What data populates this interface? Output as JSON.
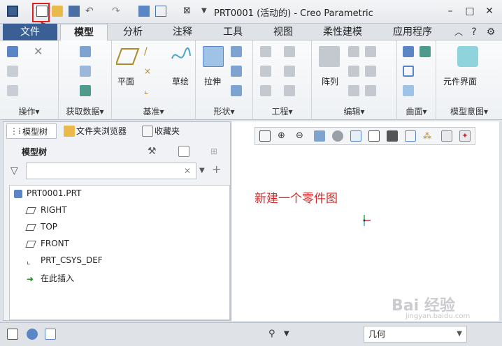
{
  "titlebar": {
    "title": "PRT0001 (活动的) - Creo Parametric",
    "quick_access": [
      "window-icon",
      "new-file-icon",
      "open-folder-icon",
      "save-icon",
      "undo-icon",
      "redo-icon",
      "regenerate-icon",
      "windows-icon",
      "close-window-icon"
    ]
  },
  "tabs": {
    "file": "文件",
    "items": [
      "模型",
      "分析",
      "注释",
      "工具",
      "视图",
      "柔性建模",
      "应用程序"
    ],
    "active": "模型"
  },
  "ribbon": {
    "groups": {
      "operations": "操作▾",
      "get_data": "获取数据▾",
      "datum": "基准▾",
      "shapes": "形状▾",
      "engineering": "工程▾",
      "editing": "编辑▾",
      "surfaces": "曲面▾",
      "model_intent": "模型意图▾"
    },
    "buttons": {
      "plane": "平面",
      "sketch": "草绘",
      "extrude": "拉伸",
      "pattern": "阵列",
      "component_interface": "元件界面"
    }
  },
  "left_panel": {
    "tabs": [
      "模型树",
      "文件夹浏览器",
      "收藏夹"
    ],
    "header": "模型树",
    "search_placeholder": "",
    "tree": [
      {
        "label": "PRT0001.PRT",
        "icon": "part-icon"
      },
      {
        "label": "RIGHT",
        "icon": "datum-plane-icon"
      },
      {
        "label": "TOP",
        "icon": "datum-plane-icon"
      },
      {
        "label": "FRONT",
        "icon": "datum-plane-icon"
      },
      {
        "label": "PRT_CSYS_DEF",
        "icon": "csys-icon"
      },
      {
        "label": "在此插入",
        "icon": "insert-arrow-icon"
      }
    ]
  },
  "graphics": {
    "annotation": "新建一个零件图"
  },
  "statusbar": {
    "filter_value": "几何"
  },
  "watermark": {
    "text": "Bai 经验",
    "sub": "jingyan.baidu.com"
  },
  "colors": {
    "file_tab": "#3a5f95",
    "annotation": "#d52a2a",
    "highlight_box": "#e02020"
  }
}
